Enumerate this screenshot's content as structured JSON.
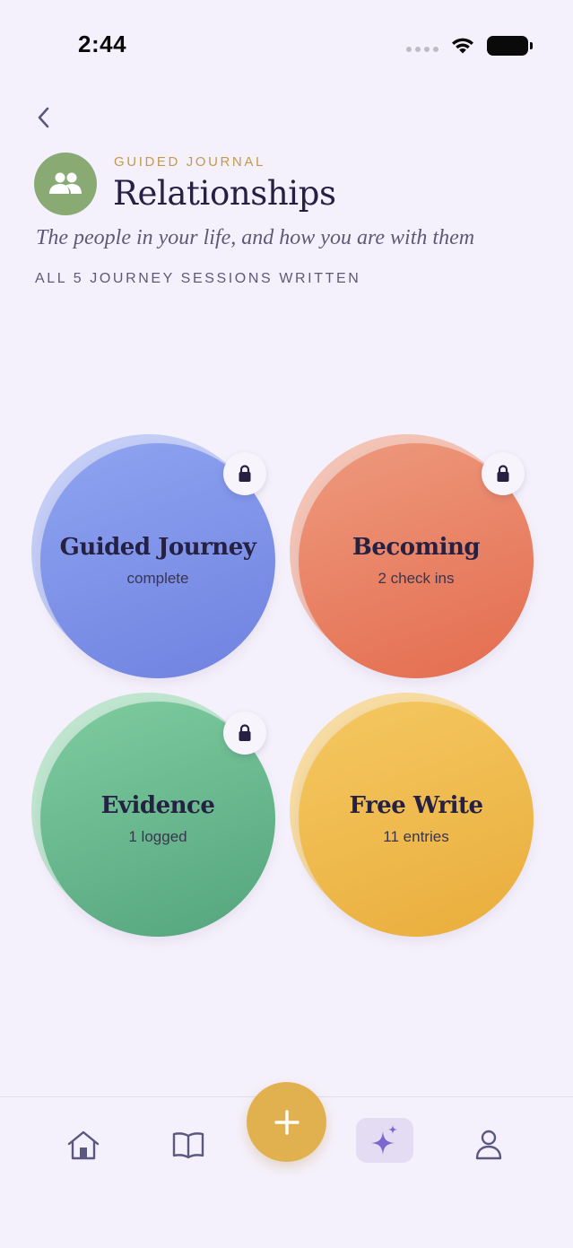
{
  "status_bar": {
    "time": "2:44"
  },
  "header": {
    "eyebrow": "GUIDED JOURNAL",
    "title": "Relationships",
    "subtitle": "The people in your life, and how you are with them",
    "status": "ALL 5 JOURNEY SESSIONS WRITTEN",
    "avatar_icon": "people-icon",
    "avatar_color": "#8aaa74"
  },
  "cards": [
    {
      "label": "Guided Journey",
      "sub": "complete",
      "locked": true,
      "color": "#7d91ea"
    },
    {
      "label": "Becoming",
      "sub": "2 check ins",
      "locked": true,
      "color": "#e8805f"
    },
    {
      "label": "Evidence",
      "sub": "1 logged",
      "locked": true,
      "color": "#67b68e"
    },
    {
      "label": "Free Write",
      "sub": "11 entries",
      "locked": false,
      "color": "#f0bb4c"
    }
  ],
  "tabbar": {
    "items": [
      "home-icon",
      "book-icon",
      "add-icon",
      "sparkle-icon",
      "profile-icon"
    ],
    "active": "sparkle-icon",
    "fab_color": "#e2b14f"
  }
}
